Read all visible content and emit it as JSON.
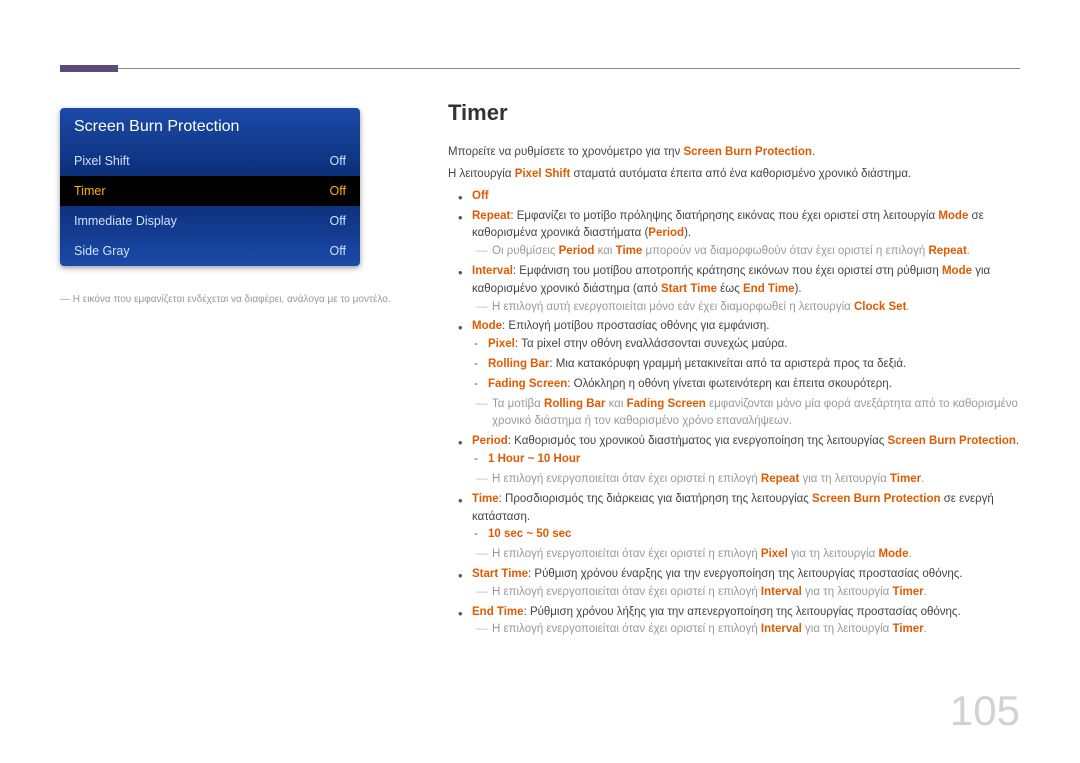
{
  "menu": {
    "title": "Screen Burn Protection",
    "items": [
      {
        "label": "Pixel Shift",
        "value": "Off",
        "selected": false
      },
      {
        "label": "Timer",
        "value": "Off",
        "selected": true
      },
      {
        "label": "Immediate Display",
        "value": "Off",
        "selected": false
      },
      {
        "label": "Side Gray",
        "value": "Off",
        "selected": false
      }
    ]
  },
  "caption_prefix": "― ",
  "caption": "Η εικόνα που εμφανίζεται ενδέχεται να διαφέρει, ανάλογα με το μοντέλο.",
  "heading": "Timer",
  "intro1_a": "Μπορείτε να ρυθμίσετε το χρονόμετρο για την ",
  "intro1_b": "Screen Burn Protection",
  "intro1_c": ".",
  "intro2_a": "Η λειτουργία ",
  "intro2_b": "Pixel Shift",
  "intro2_c": " σταματά αυτόματα έπειτα από ένα καθορισμένο χρονικό διάστημα.",
  "b_off": "Off",
  "b_repeat_k": "Repeat",
  "b_repeat_a": ": Εμφανίζει το μοτίβο πρόληψης διατήρησης εικόνας που έχει οριστεί στη λειτουργία ",
  "b_repeat_b": "Mode",
  "b_repeat_c": " σε καθορισμένα χρονικά διαστήματα (",
  "b_repeat_d": "Period",
  "b_repeat_e": ").",
  "n_repeat_a": "Οι ρυθμίσεις ",
  "n_repeat_b": "Period",
  "n_repeat_c": " και ",
  "n_repeat_d": "Time",
  "n_repeat_e": " μπορούν να διαμορφωθούν όταν έχει οριστεί η επιλογή ",
  "n_repeat_f": "Repeat",
  "n_repeat_g": ".",
  "b_interval_k": "Interval",
  "b_interval_a": ": Εμφάνιση του μοτίβου αποτροπής κράτησης εικόνων που έχει οριστεί στη ρύθμιση ",
  "b_interval_b": "Mode",
  "b_interval_c": " για καθορισμένο χρονικό διάστημα (από ",
  "b_interval_d": "Start Time",
  "b_interval_e": " έως ",
  "b_interval_f": "End Time",
  "b_interval_g": ").",
  "n_interval_a": "Η επιλογή αυτή ενεργοποιείται μόνο εάν έχει διαμορφωθεί η λειτουργία ",
  "n_interval_b": "Clock Set",
  "n_interval_c": ".",
  "b_mode_k": "Mode",
  "b_mode_a": ": Επιλογή μοτίβου προστασίας οθόνης για εμφάνιση.",
  "s_pixel_k": "Pixel",
  "s_pixel_a": ": Τα pixel στην οθόνη εναλλάσσονται συνεχώς μαύρα.",
  "s_roll_k": "Rolling Bar",
  "s_roll_a": ": Μια κατακόρυφη γραμμή μετακινείται από τα αριστερά προς τα δεξιά.",
  "s_fade_k": "Fading Screen",
  "s_fade_a": ": Ολόκληρη η οθόνη γίνεται φωτεινότερη και έπειτα σκουρότερη.",
  "n_mode_a": "Τα μοτίβα ",
  "n_mode_b": "Rolling Bar",
  "n_mode_c": " και ",
  "n_mode_d": "Fading Screen",
  "n_mode_e": " εμφανίζονται μόνο μία φορά ανεξάρτητα από το καθορισμένο χρονικό διάστημα ή τον καθορισμένο χρόνο επαναλήψεων.",
  "b_period_k": "Period",
  "b_period_a": ": Καθορισμός του χρονικού διαστήματος για ενεργοποίηση της λειτουργίας ",
  "b_period_b": "Screen Burn Protection",
  "b_period_c": ".",
  "s_period_range": "1 Hour ~ 10 Hour",
  "n_period_a": "Η επιλογή ενεργοποιείται όταν έχει οριστεί η επιλογή ",
  "n_period_b": "Repeat",
  "n_period_c": " για τη λειτουργία ",
  "n_period_d": "Timer",
  "n_period_e": ".",
  "b_time_k": "Time",
  "b_time_a": ": Προσδιορισμός της διάρκειας για διατήρηση της λειτουργίας ",
  "b_time_b": "Screen Burn Protection",
  "b_time_c": " σε ενεργή κατάσταση.",
  "s_time_range": "10 sec ~ 50 sec",
  "n_time_a": "Η επιλογή ενεργοποιείται όταν έχει οριστεί η επιλογή ",
  "n_time_b": "Pixel",
  "n_time_c": " για τη λειτουργία ",
  "n_time_d": "Mode",
  "n_time_e": ".",
  "b_start_k": "Start Time",
  "b_start_a": ": Ρύθμιση χρόνου έναρξης για την ενεργοποίηση της λειτουργίας προστασίας οθόνης.",
  "n_start_a": "Η επιλογή ενεργοποιείται όταν έχει οριστεί η επιλογή ",
  "n_start_b": "Interval",
  "n_start_c": " για τη λειτουργία ",
  "n_start_d": "Timer",
  "n_start_e": ".",
  "b_end_k": "End Time",
  "b_end_a": ": Ρύθμιση χρόνου λήξης για την απενεργοποίηση της λειτουργίας προστασίας οθόνης.",
  "n_end_a": "Η επιλογή ενεργοποιείται όταν έχει οριστεί η επιλογή ",
  "n_end_b": "Interval",
  "n_end_c": " για τη λειτουργία ",
  "n_end_d": "Timer",
  "n_end_e": ".",
  "page_number": "105"
}
